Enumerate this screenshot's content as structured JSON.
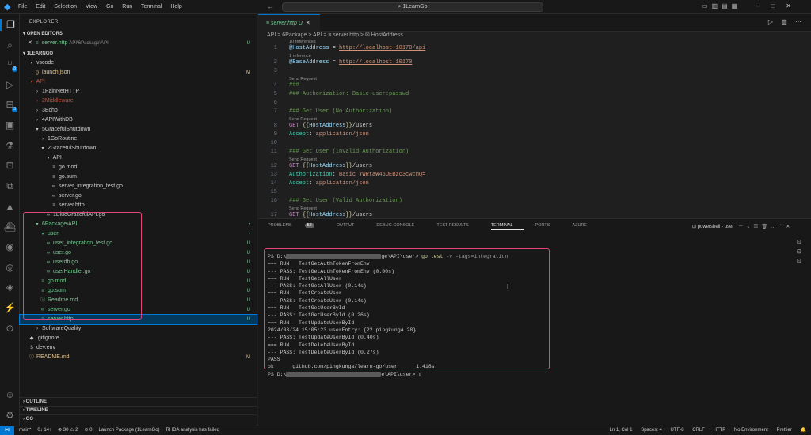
{
  "titlebar": {
    "menu": [
      "File",
      "Edit",
      "Selection",
      "View",
      "Go",
      "Run",
      "Terminal",
      "Help"
    ],
    "search": "1LearnGo"
  },
  "activity": {
    "scm_badge": "8",
    "ext_badge": "3"
  },
  "sidebar": {
    "title": "EXPLORER",
    "open_editors_label": "OPEN EDITORS",
    "open_editor": {
      "name": "server.http",
      "path": "API\\6Package\\API",
      "status": "U"
    },
    "workspace_label": "1LEARNGO",
    "tree": [
      {
        "label": "vscode",
        "indent": 1,
        "icon": "▾",
        "cls": "c-def",
        "status": ""
      },
      {
        "label": "launch.json",
        "indent": 2,
        "icon": "{}",
        "cls": "c-mod",
        "status": "M"
      },
      {
        "label": "API",
        "indent": 1,
        "icon": "▾",
        "cls": "c-del",
        "status": ""
      },
      {
        "label": "1PainNetHTTP",
        "indent": 2,
        "icon": "›",
        "cls": "c-def",
        "status": ""
      },
      {
        "label": "2Middleware",
        "indent": 2,
        "icon": "›",
        "cls": "c-del",
        "status": ""
      },
      {
        "label": "3Echo",
        "indent": 2,
        "icon": "›",
        "cls": "c-def",
        "status": ""
      },
      {
        "label": "4APIWithDB",
        "indent": 2,
        "icon": "›",
        "cls": "c-def",
        "status": ""
      },
      {
        "label": "5GracefulShutdown",
        "indent": 2,
        "icon": "▾",
        "cls": "c-def",
        "status": ""
      },
      {
        "label": "1GoRoutine",
        "indent": 3,
        "icon": "›",
        "cls": "c-def",
        "status": ""
      },
      {
        "label": "2GracefulShutdown",
        "indent": 3,
        "icon": "▾",
        "cls": "c-def",
        "status": ""
      },
      {
        "label": "API",
        "indent": 4,
        "icon": "▾",
        "cls": "c-def",
        "status": ""
      },
      {
        "label": "go.mod",
        "indent": 5,
        "icon": "≡",
        "cls": "c-def",
        "status": ""
      },
      {
        "label": "go.sum",
        "indent": 5,
        "icon": "≡",
        "cls": "c-def",
        "status": ""
      },
      {
        "label": "server_integration_test.go",
        "indent": 5,
        "icon": "∞",
        "cls": "c-def",
        "status": ""
      },
      {
        "label": "server.go",
        "indent": 5,
        "icon": "∞",
        "cls": "c-def",
        "status": ""
      },
      {
        "label": "server.http",
        "indent": 5,
        "icon": "≡",
        "cls": "c-def",
        "status": ""
      },
      {
        "label": "1BlueGracefulAPI.go",
        "indent": 4,
        "icon": "∞",
        "cls": "c-def",
        "status": ""
      },
      {
        "label": "6Package\\API",
        "indent": 2,
        "icon": "▾",
        "cls": "c-unt",
        "status": "•"
      },
      {
        "label": "user",
        "indent": 3,
        "icon": "▾",
        "cls": "c-unt",
        "status": "•"
      },
      {
        "label": "user_integration_test.go",
        "indent": 4,
        "icon": "∞",
        "cls": "c-unt",
        "status": "U"
      },
      {
        "label": "user.go",
        "indent": 4,
        "icon": "∞",
        "cls": "c-unt",
        "status": "U"
      },
      {
        "label": "userdb.go",
        "indent": 4,
        "icon": "∞",
        "cls": "c-unt",
        "status": "U"
      },
      {
        "label": "userHandler.go",
        "indent": 4,
        "icon": "∞",
        "cls": "c-unt",
        "status": "U"
      },
      {
        "label": "go.mod",
        "indent": 3,
        "icon": "≡",
        "cls": "c-unt",
        "status": "U"
      },
      {
        "label": "go.sum",
        "indent": 3,
        "icon": "≡",
        "cls": "c-unt",
        "status": "U"
      },
      {
        "label": "Readme.md",
        "indent": 3,
        "icon": "ⓘ",
        "cls": "c-unt",
        "status": "U"
      },
      {
        "label": "server.go",
        "indent": 3,
        "icon": "∞",
        "cls": "c-unt",
        "status": "U"
      },
      {
        "label": "server.http",
        "indent": 3,
        "icon": "≡",
        "cls": "c-unt",
        "status": "U",
        "selected": true
      },
      {
        "label": "SoftwareQuality",
        "indent": 2,
        "icon": "›",
        "cls": "c-def",
        "status": ""
      },
      {
        "label": ".gitignore",
        "indent": 1,
        "icon": "◆",
        "cls": "c-def",
        "status": ""
      },
      {
        "label": "dev.env",
        "indent": 1,
        "icon": "$",
        "cls": "c-def",
        "status": ""
      },
      {
        "label": "README.md",
        "indent": 1,
        "icon": "ⓘ",
        "cls": "c-mod",
        "status": "M"
      }
    ],
    "outline_label": "OUTLINE",
    "timeline_label": "TIMELINE",
    "go_label": "GO"
  },
  "tabs": [
    {
      "label": "server.http",
      "status": "U"
    }
  ],
  "breadcrumb": "API > 6Package > API > ≡ server.http > ✉ HostAddress",
  "editor": {
    "lines": [
      {
        "n": "1",
        "lens": "10 references",
        "html": "<span class='k-var'>@HostAddress</span><span class='k-op'> = </span><span class='k-url'>http://localhost:10170/api</span>"
      },
      {
        "n": "2",
        "lens": "1 reference",
        "html": "<span class='k-var'>@BaseAddress</span><span class='k-op'> = </span><span class='k-url'>http://localhost:10170</span>"
      },
      {
        "n": "3",
        "lens": "",
        "html": ""
      },
      {
        "n": "4",
        "lens": "Send Request",
        "html": "<span class='k-cm'>###</span>"
      },
      {
        "n": "5",
        "lens": "",
        "html": "<span class='k-cm'>### Authorization: Basic user:passwd</span>"
      },
      {
        "n": "6",
        "lens": "",
        "html": ""
      },
      {
        "n": "7",
        "lens": "",
        "html": "<span class='k-cm'>### Get User (No Authorization)</span>"
      },
      {
        "n": "8",
        "lens": "Send Request",
        "html": "<span class='k-m'>GET </span><span class='k-brace'>{{</span><span class='k-var'>HostAddress</span><span class='k-brace'>}}</span><span class='k-op'>/users</span>"
      },
      {
        "n": "9",
        "lens": "",
        "html": "<span class='k-h'>Accept</span><span class='k-op'>: </span><span class='k-val'>application/json</span>"
      },
      {
        "n": "10",
        "lens": "",
        "html": ""
      },
      {
        "n": "11",
        "lens": "",
        "html": "<span class='k-cm'>### Get User (Invalid Authorization)</span>"
      },
      {
        "n": "12",
        "lens": "Send Request",
        "html": "<span class='k-m'>GET </span><span class='k-brace'>{{</span><span class='k-var'>HostAddress</span><span class='k-brace'>}}</span><span class='k-op'>/users</span>"
      },
      {
        "n": "13",
        "lens": "",
        "html": "<span class='k-h'>Authorization</span><span class='k-op'>: </span><span class='k-val'>Basic YWRtaW46UEBzc3cwcmQ=</span>"
      },
      {
        "n": "14",
        "lens": "",
        "html": "<span class='k-h'>Accept</span><span class='k-op'>: </span><span class='k-val'>application/json</span>"
      },
      {
        "n": "15",
        "lens": "",
        "html": ""
      },
      {
        "n": "16",
        "lens": "",
        "html": "<span class='k-cm'>### Get User (Valid Authorization)</span>"
      },
      {
        "n": "17",
        "lens": "Send Request",
        "html": "<span class='k-m'>GET </span><span class='k-brace'>{{</span><span class='k-var'>HostAddress</span><span class='k-brace'>}}</span><span class='k-op'>/users</span>"
      }
    ]
  },
  "panel": {
    "tabs": [
      "PROBLEMS",
      "OUTPUT",
      "DEBUG CONSOLE",
      "TEST RESULTS",
      "TERMINAL",
      "PORTS",
      "AZURE"
    ],
    "problems_count": "52",
    "active_tab": "TERMINAL",
    "terminal_name": "powershell - user",
    "prompt_prefix": "PS D:\\",
    "prompt_suffix": "ge\\API\\user> ",
    "command": "go test",
    "flags": " -v -tags=integration",
    "output": [
      "=== RUN   TestGetAuthTokenFromEnv",
      "--- PASS: TestGetAuthTokenFromEnv (0.00s)",
      "=== RUN   TestGetAllUser",
      "--- PASS: TestGetAllUser (0.14s)",
      "=== RUN   TestCreateUser",
      "--- PASS: TestCreateUser (0.14s)",
      "=== RUN   TestGetUserById",
      "--- PASS: TestGetUserById (0.26s)",
      "=== RUN   TestUpdateUserById",
      "2024/03/24 15:05:23 userEntry: {22 pingkungA 28}",
      "--- PASS: TestUpdateUserById (0.40s)",
      "=== RUN   TestDeleteUserById",
      "--- PASS: TestDeleteUserById (0.27s)",
      "PASS",
      "ok      github.com/pingkunga/learn-go/user      1.418s"
    ],
    "final_prompt_suffix": "e\\API\\user> "
  },
  "statusbar": {
    "branch": "main*",
    "sync": "0↓ 14↑",
    "problems": "⊗ 30 ⚠ 2",
    "ports": "⊙ 0",
    "launch": "Launch Package (1LearnGo)",
    "rhda": "RHDA analysis has failed",
    "position": "Ln 1, Col 1",
    "spaces": "Spaces: 4",
    "encoding": "UTF-8",
    "eol": "CRLF",
    "language": "HTTP",
    "env": "No Environment",
    "prettier": "Prettier"
  }
}
